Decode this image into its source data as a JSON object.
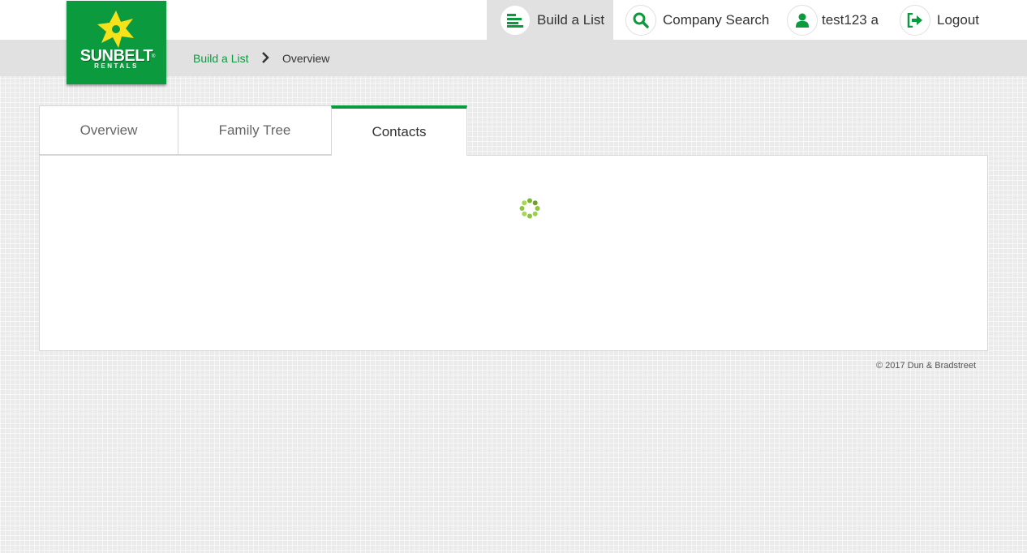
{
  "brand": {
    "name": "SUNBELT",
    "tagline": "RENTALS",
    "registered": "®",
    "color": "#0b9a3e",
    "sun_color": "#f5e21a"
  },
  "nav": {
    "items": [
      {
        "label": "Build a List",
        "icon": "list-icon",
        "active": true
      },
      {
        "label": "Company Search",
        "icon": "search-icon"
      },
      {
        "label": "test123 a",
        "icon": "user-icon"
      },
      {
        "label": "Logout",
        "icon": "logout-icon"
      }
    ]
  },
  "breadcrumb": {
    "items": [
      "Build a List",
      "Overview"
    ]
  },
  "tabs": [
    {
      "label": "Overview"
    },
    {
      "label": "Family Tree"
    },
    {
      "label": "Contacts",
      "active": true
    }
  ],
  "content": {
    "state": "loading",
    "spinner_color": "#8cc63f"
  },
  "footer": {
    "copyright": "© 2017 Dun & Bradstreet"
  }
}
